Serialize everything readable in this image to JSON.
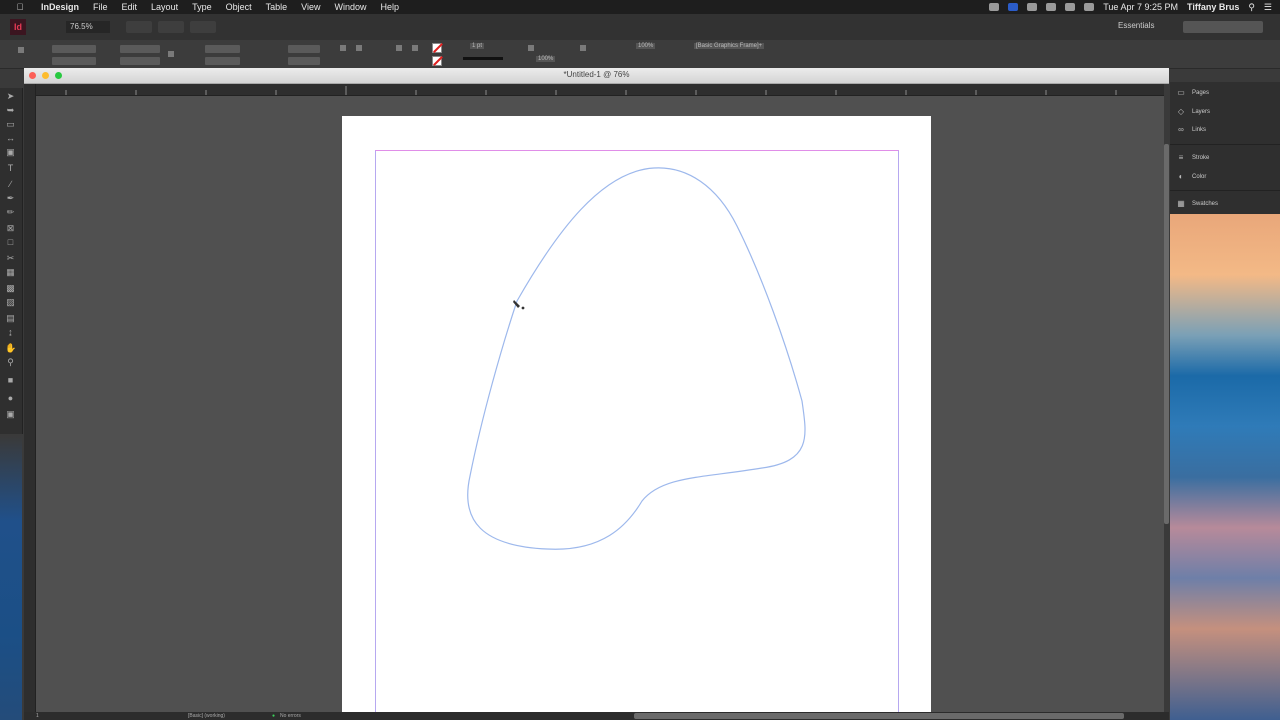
{
  "menubar": {
    "app_name": "InDesign",
    "menus": [
      "File",
      "Edit",
      "Layout",
      "Type",
      "Object",
      "Table",
      "View",
      "Window",
      "Help"
    ],
    "clock": "Tue Apr 7  9:25 PM",
    "user": "Tiffany Brus"
  },
  "appbar": {
    "logo": "Id",
    "zoom": "76.5%",
    "workspace": "Essentials"
  },
  "document": {
    "title": "*Untitled-1 @ 76%"
  },
  "control_panel": {
    "stroke_weight": "1 pt",
    "percent": "100%",
    "opacity": "100%",
    "style": "[Basic Graphics Frame]+"
  },
  "dock": {
    "items": [
      "Pages",
      "Layers",
      "Links",
      "Stroke",
      "Color",
      "Swatches"
    ]
  },
  "statusbar": {
    "page": "1",
    "profile": "[Basic] (working)",
    "preflight": "No errors"
  },
  "colors": {
    "path_stroke": "#9db8ec",
    "margin_top": "#e08ee8",
    "margin_side": "#b6a8f0"
  }
}
